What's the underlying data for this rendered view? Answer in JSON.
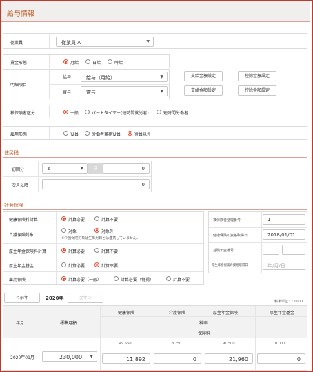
{
  "header": {
    "title": "給与情報"
  },
  "employee": {
    "label": "従業員",
    "value": "従業員 A"
  },
  "pay_type": {
    "label": "賃金形態",
    "options": [
      "月給",
      "日給",
      "時給"
    ],
    "selected": 0
  },
  "pay_items": {
    "label": "明細項目",
    "salary_label": "給与",
    "salary_value": "給与（月給）",
    "bonus_label": "賞与",
    "bonus_value": "賞与",
    "salary_pay_setting": "支給金額設定",
    "salary_deduct_setting": "控除金額設定",
    "bonus_pay_setting": "支給金額設定",
    "bonus_deduct_setting": "控除金額設定"
  },
  "insured_type": {
    "label": "被保険者区分",
    "options": [
      "一般",
      "パートタイマー(短時間就労者)",
      "短時間労働者"
    ],
    "selected": 0
  },
  "employment_type": {
    "label": "雇用形態",
    "options": [
      "役員",
      "労働者兼務役員",
      "役員以外"
    ],
    "selected": 2
  },
  "resident_tax": {
    "section": "住民税",
    "first_label": "初回分",
    "first_month": "6",
    "month_unit": "月",
    "first_amount": "0",
    "next_label": "次月以降",
    "next_amount": "0"
  },
  "social_insurance": {
    "section": "社会保険",
    "health_label": "健康保険料計算",
    "health_options": [
      "計算必要",
      "計算不要"
    ],
    "health_selected": 0,
    "care_label": "介護保険対象",
    "care_options": [
      "対象",
      "対象外"
    ],
    "care_selected": 1,
    "care_note": "※介護保険対象は生年月日とは連携していません。",
    "pension_label": "厚生年金保険料計算",
    "pension_options": [
      "計算必要",
      "計算不要"
    ],
    "pension_selected": 0,
    "fund_label": "厚生年金基金",
    "fund_options": [
      "計算必要",
      "計算不要"
    ],
    "fund_selected": 1,
    "emp_label": "雇用保険",
    "emp_options": [
      "計算必要（一般）",
      "計算必要（特掲）",
      "計算不要"
    ],
    "emp_selected": 0,
    "ins_no_label": "被保険者整理番号",
    "ins_no_value": "1",
    "health_date_label": "健康保険の資格取得日",
    "health_date_value": "2018/01/01",
    "pension_no_label": "基礎年金番号",
    "pension_date_label": "厚生年金保険の資格取得日",
    "pension_date_placeholder": "年/月/日"
  },
  "year_nav": {
    "prev": "＜前年",
    "year": "2020年",
    "next": "翌年＞",
    "unit": "料率単位：/ 1000"
  },
  "table": {
    "col_month": "年月",
    "col_std": "標準月額",
    "cols": [
      "健康保険",
      "介護保険",
      "厚生年金保険",
      "厚生年金基金"
    ],
    "rate_label": "料率",
    "premium_label": "保険料",
    "rates": [
      "49.550",
      "8.250",
      "91.500",
      "0.000"
    ],
    "row_month": "2020年01月",
    "row_std": "230,000",
    "premiums": [
      "11,892",
      "0",
      "21,960",
      "0"
    ]
  }
}
